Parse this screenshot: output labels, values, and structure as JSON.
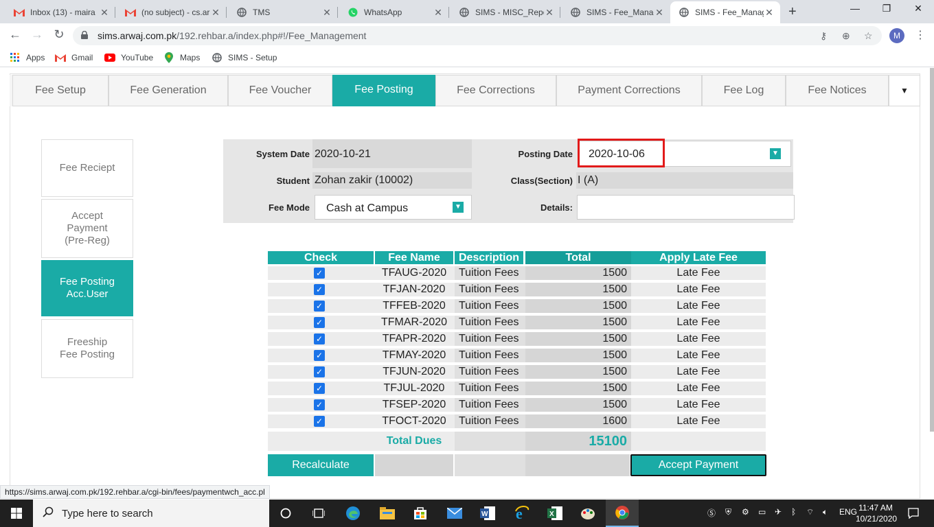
{
  "browser": {
    "tabs": [
      {
        "title": "Inbox (13) - maira",
        "icon": "gmail-icon"
      },
      {
        "title": "(no subject) - cs.ar",
        "icon": "gmail-icon"
      },
      {
        "title": "TMS",
        "icon": "globe-icon"
      },
      {
        "title": "WhatsApp",
        "icon": "whatsapp-icon"
      },
      {
        "title": "SIMS - MISC_Repo",
        "icon": "globe-icon"
      },
      {
        "title": "SIMS - Fee_Manag",
        "icon": "globe-icon"
      },
      {
        "title": "SIMS - Fee_Manag",
        "icon": "globe-icon"
      }
    ],
    "url_host": "sims.arwaj.com.pk",
    "url_path": "/192.rehbar.a/index.php#!/Fee_Management",
    "profile_initial": "M",
    "bookmarks": [
      "Apps",
      "Gmail",
      "YouTube",
      "Maps",
      "SIMS - Setup"
    ]
  },
  "nav_tabs": [
    "Fee Setup",
    "Fee Generation",
    "Fee Voucher",
    "Fee Posting",
    "Fee Corrections",
    "Payment Corrections",
    "Fee Log",
    "Fee Notices"
  ],
  "side_menu": {
    "fee_reciept": "Fee Reciept",
    "accept_payment": [
      "Accept",
      "Payment",
      "(Pre-Reg)"
    ],
    "fee_posting_acc": [
      "Fee Posting",
      "Acc.User"
    ],
    "freeship": [
      "Freeship",
      "Fee Posting"
    ]
  },
  "form": {
    "system_date_label": "System Date",
    "system_date": "2020-10-21",
    "posting_date_label": "Posting Date",
    "posting_date": "2020-10-06",
    "student_label": "Student",
    "student": "Zohan zakir (10002)",
    "class_label": "Class(Section)",
    "class": "I (A)",
    "fee_mode_label": "Fee Mode",
    "fee_mode": "Cash at Campus",
    "details_label": "Details:",
    "details": ""
  },
  "table": {
    "headers": [
      "Check",
      "Fee Name",
      "Description",
      "Total",
      "Apply Late Fee"
    ],
    "rows": [
      {
        "name": "TFAUG-2020",
        "desc": "Tuition Fees",
        "total": "1500",
        "late": "Late Fee"
      },
      {
        "name": "TFJAN-2020",
        "desc": "Tuition Fees",
        "total": "1500",
        "late": "Late Fee"
      },
      {
        "name": "TFFEB-2020",
        "desc": "Tuition Fees",
        "total": "1500",
        "late": "Late Fee"
      },
      {
        "name": "TFMAR-2020",
        "desc": "Tuition Fees",
        "total": "1500",
        "late": "Late Fee"
      },
      {
        "name": "TFAPR-2020",
        "desc": "Tuition Fees",
        "total": "1500",
        "late": "Late Fee"
      },
      {
        "name": "TFMAY-2020",
        "desc": "Tuition Fees",
        "total": "1500",
        "late": "Late Fee"
      },
      {
        "name": "TFJUN-2020",
        "desc": "Tuition Fees",
        "total": "1500",
        "late": "Late Fee"
      },
      {
        "name": "TFJUL-2020",
        "desc": "Tuition Fees",
        "total": "1500",
        "late": "Late Fee"
      },
      {
        "name": "TFSEP-2020",
        "desc": "Tuition Fees",
        "total": "1500",
        "late": "Late Fee"
      },
      {
        "name": "TFOCT-2020",
        "desc": "Tuition Fees",
        "total": "1600",
        "late": "Late Fee"
      }
    ],
    "total_label": "Total Dues",
    "total_value": "15100"
  },
  "buttons": {
    "recalculate": "Recalculate",
    "accept_payment": "Accept Payment"
  },
  "status_url": "https://sims.arwaj.com.pk/192.rehbar.a/cgi-bin/fees/paymentwch_acc.pl",
  "taskbar": {
    "search_placeholder": "Type here to search",
    "time": "11:47 AM",
    "date": "10/21/2020"
  },
  "colors": {
    "accent": "#1aaba6",
    "highlight": "#e21a1a"
  }
}
